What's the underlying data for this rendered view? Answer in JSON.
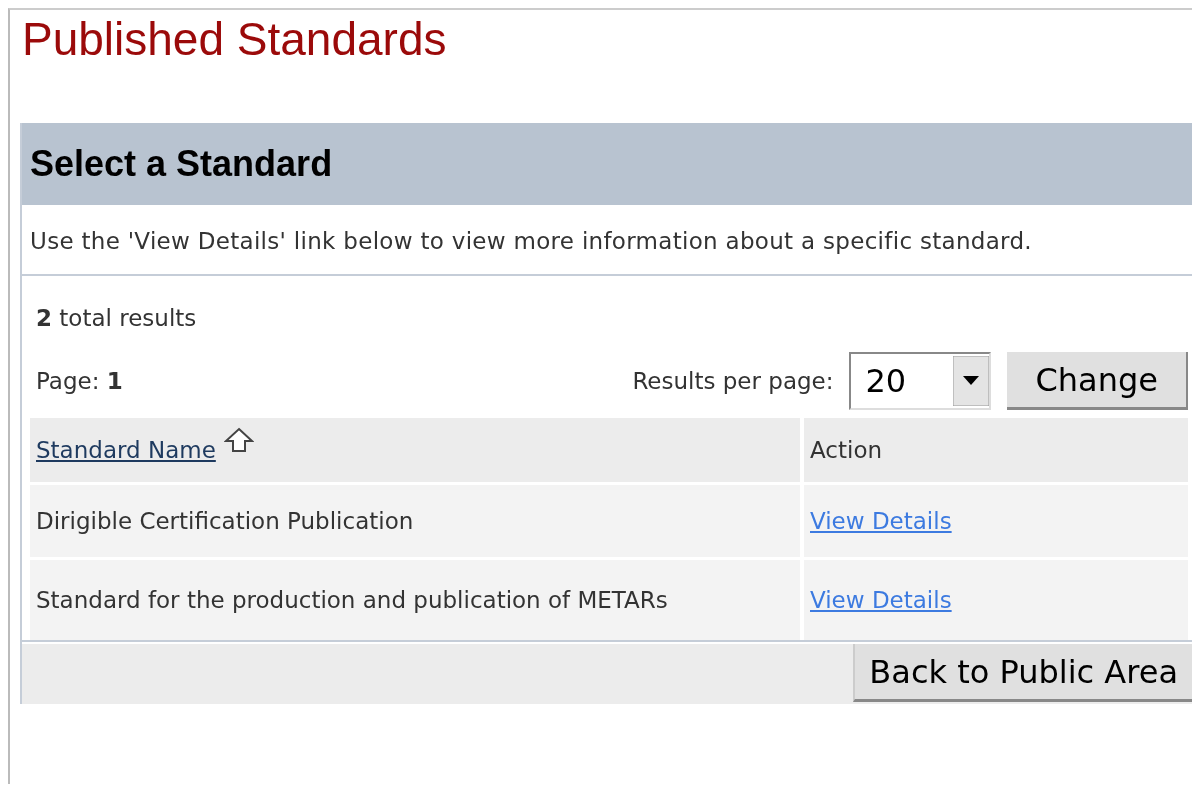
{
  "page_title": "Published Standards",
  "panel": {
    "heading": "Select a Standard",
    "description": "Use the 'View Details' link below to view more information about a specific standard."
  },
  "results": {
    "total": "**2** total results",
    "page": "Page: **1**",
    "per_page_label": "Results per page:",
    "per_page_value": "20",
    "change_button": "Change"
  },
  "table": {
    "columns": [
      {
        "label": "Standard Name",
        "kind": "sort-link"
      },
      {
        "label": "Action",
        "kind": "text"
      }
    ],
    "rows": [
      {
        "name": "Dirigible Certification Publication",
        "action": "View Details"
      },
      {
        "name": "Standard for the production and publication of METARs",
        "action": "View Details"
      }
    ]
  },
  "footer": {
    "back_button": "Back to Public Area"
  }
}
